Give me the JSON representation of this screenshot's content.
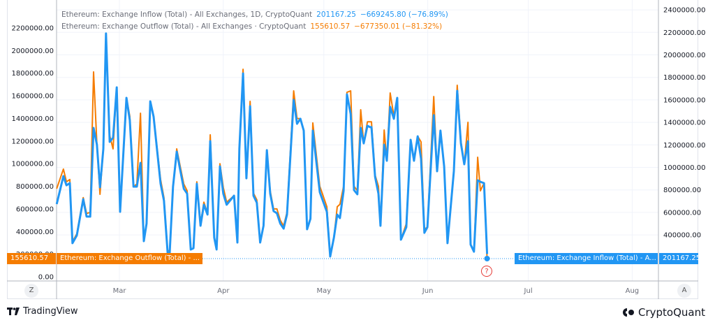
{
  "legend": {
    "inflow": {
      "title": "Ethereum: Exchange Inflow (Total) - All Exchanges, 1D, CryptoQuant",
      "value": "201167.25",
      "change": "−669245.80 (−76.89%)"
    },
    "outflow": {
      "title": "Ethereum: Exchange Outflow (Total) - All Exchanges · CryptoQuant",
      "value": "155610.57",
      "change": "−677350.01 (−81.32%)"
    }
  },
  "price_labels": {
    "outflow_value": "155610.57",
    "outflow_name": "Ethereum: Exchange Outflow (Total) - ...",
    "inflow_name": "Ethereum: Exchange Inflow (Total) - A...",
    "inflow_value": "201167.25"
  },
  "axis_buttons": {
    "left": "Z",
    "right": "A"
  },
  "question_mark": "?",
  "footer": {
    "left_brand": "TradingView",
    "right_brand": "CryptoQuant"
  },
  "colors": {
    "inflow": "#2196f3",
    "outflow": "#f57c00",
    "grid": "#f0f3fa",
    "text": "#6a6d78",
    "marker": "#e53935"
  },
  "chart_data": {
    "type": "line",
    "title": "",
    "xlabel": "",
    "ylabel": "",
    "x_unit": "day of year",
    "x_ticks": [
      {
        "label": "Mar",
        "x": 60
      },
      {
        "label": "Apr",
        "x": 91
      },
      {
        "label": "May",
        "x": 121
      },
      {
        "label": "Jun",
        "x": 152
      },
      {
        "label": "Jul",
        "x": 182
      },
      {
        "label": "Aug",
        "x": 213
      }
    ],
    "xlim": [
      41.3,
      221
    ],
    "left_axis": {
      "ylim": [
        0,
        2300000
      ],
      "ticks": [
        "0.00",
        "200000.00",
        "400000.00",
        "600000.00",
        "800000.00",
        "1000000.00",
        "1200000.00",
        "1400000.00",
        "1600000.00",
        "1800000.00",
        "2000000.00",
        "2200000.00"
      ]
    },
    "right_axis": {
      "ticks": [
        "400000.00",
        "600000.00",
        "800000.00",
        "1000000.00",
        "1200000.00",
        "1400000.00",
        "1600000.00",
        "1800000.00",
        "2000000.00",
        "2200000.00",
        "2400000.00"
      ]
    },
    "grid": true,
    "legend_position": "top-left",
    "series": [
      {
        "name": "Ethereum: Exchange Inflow (Total)",
        "color": "#2196f3",
        "x": [
          41.3,
          43.3,
          44.2,
          45.2,
          46.0,
          47.3,
          49.2,
          50.2,
          51.3,
          52.3,
          53.3,
          54.2,
          55.2,
          56.0,
          57.1,
          58.1,
          59.2,
          60.2,
          62.1,
          63.1,
          64.2,
          65.2,
          66.3,
          67.3,
          68.1,
          69.2,
          70.2,
          72.3,
          73.3,
          74.4,
          75.0,
          76.0,
          77.1,
          79.2,
          80.2,
          81.3,
          82.1,
          83.1,
          84.2,
          85.2,
          86.3,
          87.1,
          88.3,
          89.0,
          90.0,
          91.0,
          92.0,
          94.2,
          95.2,
          95.8,
          96.9,
          97.9,
          99.0,
          100,
          101,
          102,
          103,
          104,
          105,
          106,
          107,
          108,
          109,
          110,
          112,
          113,
          114,
          115,
          116,
          117,
          117.7,
          119.8,
          121.9,
          122.9,
          124,
          125,
          125.8,
          126.9,
          127.9,
          129,
          130,
          131,
          132,
          132.9,
          134,
          134.8,
          135.2,
          136.3,
          137.3,
          137.9,
          139,
          139.8,
          140.8,
          141.9,
          142.9,
          144,
          145.6,
          146.9,
          147.9,
          149,
          150,
          151,
          151.9,
          153.8,
          154.8,
          155.8,
          156.9,
          157.9,
          159.8,
          160.8,
          161.9,
          162.9,
          164,
          164.8,
          165.8,
          166.9,
          167.7,
          168.8,
          169.7
        ],
        "values": [
          643000,
          890000,
          809000,
          828000,
          297000,
          365000,
          686000,
          532000,
          532000,
          1316000,
          1168000,
          791000,
          1131000,
          2151000,
          1193000,
          1230000,
          1675000,
          575000,
          1582000,
          1384000,
          797000,
          797000,
          1007000,
          315000,
          470000,
          1551000,
          1415000,
          822000,
          674000,
          210000,
          210000,
          797000,
          1106000,
          779000,
          735000,
          241000,
          253000,
          822000,
          451000,
          637000,
          550000,
          1199000,
          346000,
          241000,
          976000,
          735000,
          637000,
          717000,
          303000,
          1131000,
          1798000,
          871000,
          1508000,
          717000,
          655000,
          303000,
          451000,
          1119000,
          735000,
          581000,
          562000,
          470000,
          426000,
          550000,
          1564000,
          1353000,
          1397000,
          1292000,
          420000,
          513000,
          1292000,
          748000,
          575000,
          179000,
          346000,
          550000,
          519000,
          760000,
          1613000,
          1440000,
          766000,
          729000,
          1316000,
          1180000,
          1335000,
          1323000,
          1323000,
          884000,
          735000,
          451000,
          1168000,
          1026000,
          1502000,
          1397000,
          1582000,
          328000,
          439000,
          1211000,
          1026000,
          1242000,
          1044000,
          389000,
          439000,
          1428000,
          933000,
          1292000,
          976000,
          297000,
          933000,
          1644000,
          1180000,
          995000,
          1199000,
          284000,
          222000,
          853000,
          840000,
          828000,
          201167.25
        ]
      },
      {
        "name": "Ethereum: Exchange Outflow (Total)",
        "color": "#f57c00",
        "x": [
          41.3,
          43.3,
          44.2,
          45.2,
          46.0,
          47.3,
          49.2,
          50.2,
          51.3,
          52.3,
          53.3,
          54.2,
          55.2,
          56.0,
          57.1,
          58.1,
          59.2,
          60.2,
          62.1,
          63.1,
          64.2,
          65.2,
          66.3,
          67.3,
          68.1,
          69.2,
          70.2,
          72.3,
          73.3,
          74.4,
          75.0,
          76.0,
          77.1,
          79.2,
          80.2,
          81.3,
          82.1,
          83.1,
          84.2,
          85.2,
          86.3,
          87.1,
          88.3,
          89.0,
          90.0,
          91.0,
          92.0,
          94.2,
          95.2,
          95.8,
          96.9,
          97.9,
          99.0,
          100,
          101,
          102,
          103,
          104,
          105,
          106,
          107,
          108,
          109,
          110,
          112,
          113,
          114,
          115,
          116,
          117,
          117.7,
          119.8,
          121.9,
          122.9,
          124,
          125,
          125.8,
          126.9,
          127.9,
          129,
          130,
          131,
          132,
          132.9,
          134,
          134.8,
          135.2,
          136.3,
          137.3,
          137.9,
          139,
          139.8,
          140.8,
          141.9,
          142.9,
          144,
          145.6,
          146.9,
          147.9,
          149,
          150,
          151,
          151.9,
          153.8,
          154.8,
          155.8,
          156.9,
          157.9,
          159.8,
          160.8,
          161.9,
          162.9,
          164,
          164.8,
          165.8,
          166.9,
          167.7,
          168.8,
          169.7
        ],
        "values": [
          779000,
          952000,
          840000,
          860000,
          310000,
          380000,
          700000,
          560000,
          570000,
          1811000,
          1168000,
          729000,
          1131000,
          2151000,
          1250000,
          1131000,
          1675000,
          575000,
          1582000,
          1420000,
          797000,
          820000,
          1446000,
          315000,
          470000,
          1551000,
          1415000,
          860000,
          700000,
          230000,
          230000,
          797000,
          1131000,
          820000,
          760000,
          241000,
          253000,
          840000,
          470000,
          660000,
          560000,
          1255000,
          346000,
          241000,
          1000000,
          790000,
          660000,
          717000,
          303000,
          1131000,
          1835000,
          871000,
          1551000,
          740000,
          680000,
          303000,
          451000,
          1119000,
          760000,
          600000,
          600000,
          500000,
          450000,
          570000,
          1644000,
          1400000,
          1397000,
          1292000,
          420000,
          513000,
          1360000,
          800000,
          620000,
          179000,
          346000,
          620000,
          640000,
          800000,
          1631000,
          1644000,
          800000,
          760000,
          1477000,
          1180000,
          1370000,
          1370000,
          1370000,
          900000,
          800000,
          451000,
          1298000,
          1026000,
          1625000,
          1420000,
          1582000,
          328000,
          470000,
          1211000,
          1026000,
          1242000,
          1193000,
          420000,
          439000,
          1594000,
          933000,
          1292000,
          976000,
          297000,
          933000,
          1693000,
          1200000,
          995000,
          1366000,
          290000,
          222000,
          1057000,
          760000,
          828000,
          155610.57
        ]
      }
    ]
  }
}
